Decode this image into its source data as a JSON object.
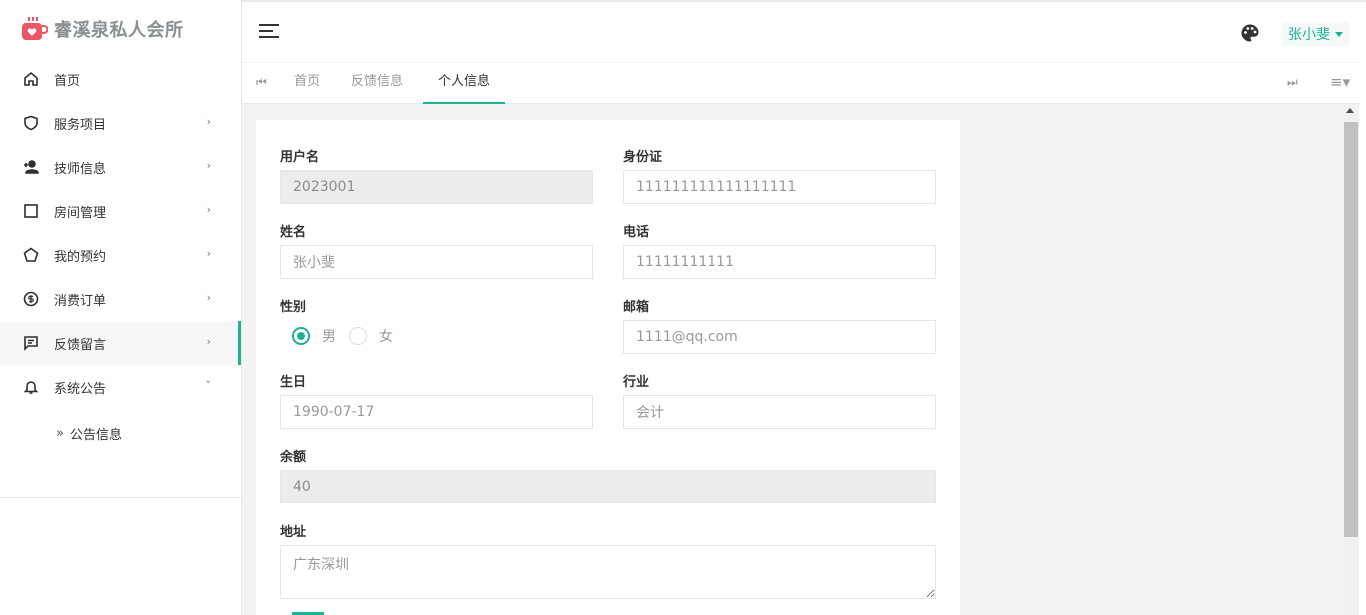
{
  "app": {
    "brand": "睿溪泉私人会所"
  },
  "sidebar": {
    "items": [
      {
        "label": "首页",
        "icon": "home-icon"
      },
      {
        "label": "服务项目",
        "icon": "shield-icon"
      },
      {
        "label": "技师信息",
        "icon": "user-add-icon"
      },
      {
        "label": "房间管理",
        "icon": "square-icon"
      },
      {
        "label": "我的预约",
        "icon": "pentagon-icon"
      },
      {
        "label": "消费订单",
        "icon": "coin-icon"
      },
      {
        "label": "反馈留言",
        "icon": "message-icon"
      },
      {
        "label": "系统公告",
        "icon": "bell-icon"
      }
    ],
    "chevron": "›",
    "chevron_open": "˅",
    "sub_items": [
      {
        "label": "公告信息"
      }
    ]
  },
  "header": {
    "user_name": "张小斐"
  },
  "tabs": {
    "items": [
      {
        "label": "首页"
      },
      {
        "label": "反馈信息"
      },
      {
        "label": "个人信息"
      }
    ],
    "active_index": 2,
    "prev_symbol": "⏮",
    "next_symbol": "⏭",
    "menu_symbol": "≡▾"
  },
  "form": {
    "username": {
      "label": "用户名",
      "value": "2023001"
    },
    "id_card": {
      "label": "身份证",
      "value": "111111111111111111"
    },
    "name": {
      "label": "姓名",
      "value": "张小斐"
    },
    "phone": {
      "label": "电话",
      "value": "11111111111"
    },
    "gender": {
      "label": "性别",
      "options": [
        "男",
        "女"
      ],
      "selected": "男"
    },
    "email": {
      "label": "邮箱",
      "value": "1111@qq.com"
    },
    "birthday": {
      "label": "生日",
      "value": "1990-07-17"
    },
    "industry": {
      "label": "行业",
      "value": "会计"
    },
    "balance": {
      "label": "余额",
      "value": "40"
    },
    "address": {
      "label": "地址",
      "value": "广东深圳"
    }
  },
  "colors": {
    "accent": "#1ab394",
    "brand_icon": "#ed5565"
  }
}
